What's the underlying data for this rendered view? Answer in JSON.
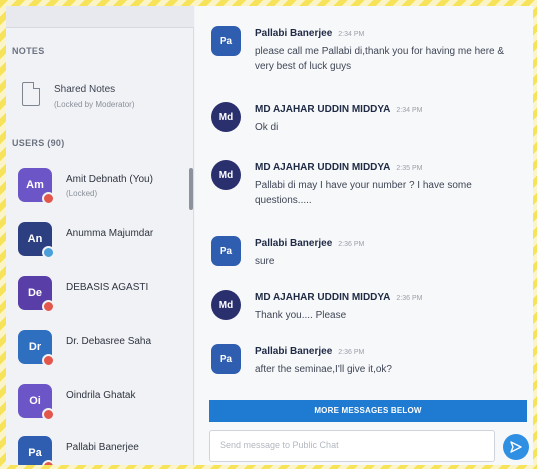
{
  "sidebar": {
    "notes_section_label": "NOTES",
    "shared_notes": {
      "title": "Shared Notes",
      "subtitle": "(Locked by Moderator)"
    },
    "users_section_label": "USERS (90)",
    "users": [
      {
        "initials": "Am",
        "name": "Amit Debnath (You)",
        "subtitle": "(Locked)",
        "color": "#6b55c7",
        "status_color": "#e2564b"
      },
      {
        "initials": "An",
        "name": "Anumma Majumdar",
        "subtitle": "",
        "color": "#2c3f80",
        "status_color": "#4a9fd8"
      },
      {
        "initials": "De",
        "name": "DEBASIS AGASTI",
        "subtitle": "",
        "color": "#5a3ea8",
        "status_color": "#e2564b"
      },
      {
        "initials": "Dr",
        "name": "Dr. Debasree Saha",
        "subtitle": "",
        "color": "#2f6fc0",
        "status_color": "#e2564b"
      },
      {
        "initials": "Oi",
        "name": "Oindrila Ghatak",
        "subtitle": "",
        "color": "#6b55c7",
        "status_color": "#e2564b"
      },
      {
        "initials": "Pa",
        "name": "Pallabi Banerjee",
        "subtitle": "",
        "color": "#2f5db0",
        "status_color": "#e2564b"
      }
    ]
  },
  "chat": {
    "messages": [
      {
        "initials": "Pa",
        "sender": "Pallabi Banerjee",
        "time": "2:34 PM",
        "text": "please call me Pallabi di,thank you for having me here & very best of luck guys",
        "color": "#2f5db0",
        "round": false
      },
      {
        "initials": "Md",
        "sender": "MD AJAHAR UDDIN MIDDYA",
        "time": "2:34 PM",
        "text": "Ok di",
        "color": "#2a2f6e",
        "round": true
      },
      {
        "initials": "Md",
        "sender": "MD AJAHAR UDDIN MIDDYA",
        "time": "2:35 PM",
        "text": "Pallabi di may I have your number ? I have some questions.....",
        "color": "#2a2f6e",
        "round": true
      },
      {
        "initials": "Pa",
        "sender": "Pallabi Banerjee",
        "time": "2:36 PM",
        "text": "sure",
        "color": "#2f5db0",
        "round": false
      },
      {
        "initials": "Md",
        "sender": "MD AJAHAR UDDIN MIDDYA",
        "time": "2:36 PM",
        "text": "Thank you.... Please",
        "color": "#2a2f6e",
        "round": true
      },
      {
        "initials": "Pa",
        "sender": "Pallabi Banerjee",
        "time": "2:36 PM",
        "text": "after the seminae,I'll give it,ok?",
        "color": "#2f5db0",
        "round": false
      }
    ],
    "more_messages_label": "MORE MESSAGES BELOW",
    "composer_placeholder": "Send message to Public Chat"
  }
}
